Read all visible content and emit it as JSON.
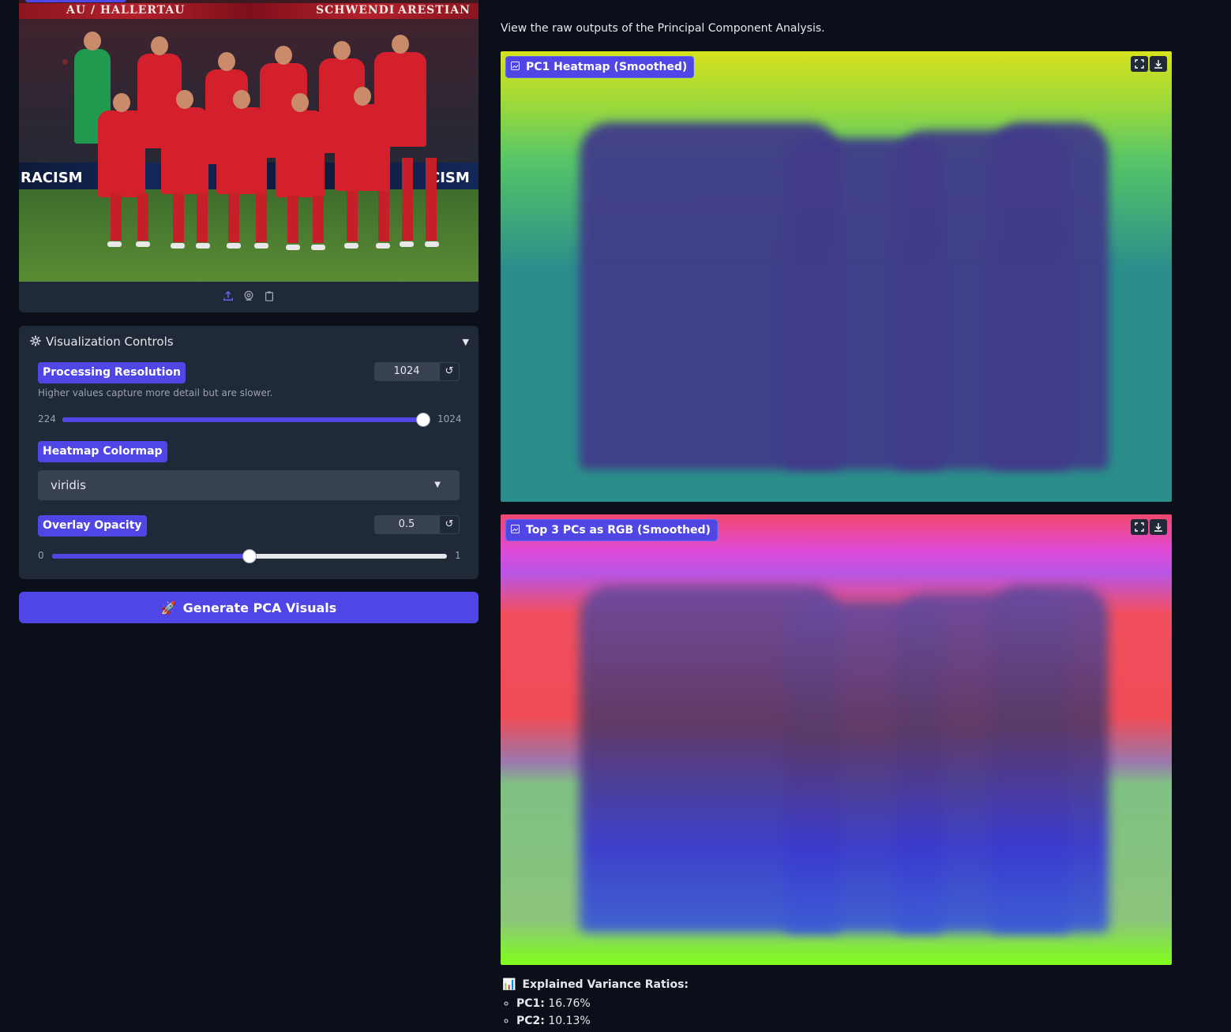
{
  "input_image": {
    "banner_left": "AU / HALLERTAU",
    "banner_mid": "SCHWENDI",
    "banner_right": "ARESTIAN",
    "board_left": "RACISM",
    "board_right": "CISM",
    "toolbar_icons": [
      "upload-icon",
      "webcam-icon",
      "clipboard-icon"
    ]
  },
  "controls": {
    "title": "Visualization Controls",
    "resolution": {
      "label": "Processing Resolution",
      "value": "1024",
      "hint": "Higher values capture more detail but are slower.",
      "min": "224",
      "max": "1024",
      "fraction": 1.0
    },
    "colormap": {
      "label": "Heatmap Colormap",
      "selected": "viridis"
    },
    "opacity": {
      "label": "Overlay Opacity",
      "value": "0.5",
      "min": "0",
      "max": "1",
      "fraction": 0.5
    },
    "reset_glyph": "↺"
  },
  "generate_button": {
    "label": "Generate PCA Visuals",
    "emoji": "🚀"
  },
  "results": {
    "intro": "View the raw outputs of the Principal Component Analysis.",
    "pc1_label": "PC1 Heatmap (Smoothed)",
    "rgb_label": "Top 3 PCs as RGB (Smoothed)",
    "variance_title": "Explained Variance Ratios:",
    "variance_emoji": "📊",
    "variance_items": [
      {
        "name": "PC1:",
        "value": "16.76%"
      },
      {
        "name": "PC2:",
        "value": "10.13%"
      }
    ]
  },
  "colors": {
    "accent": "#4f46e5",
    "panel": "#1f2937",
    "background": "#0b0f19"
  }
}
